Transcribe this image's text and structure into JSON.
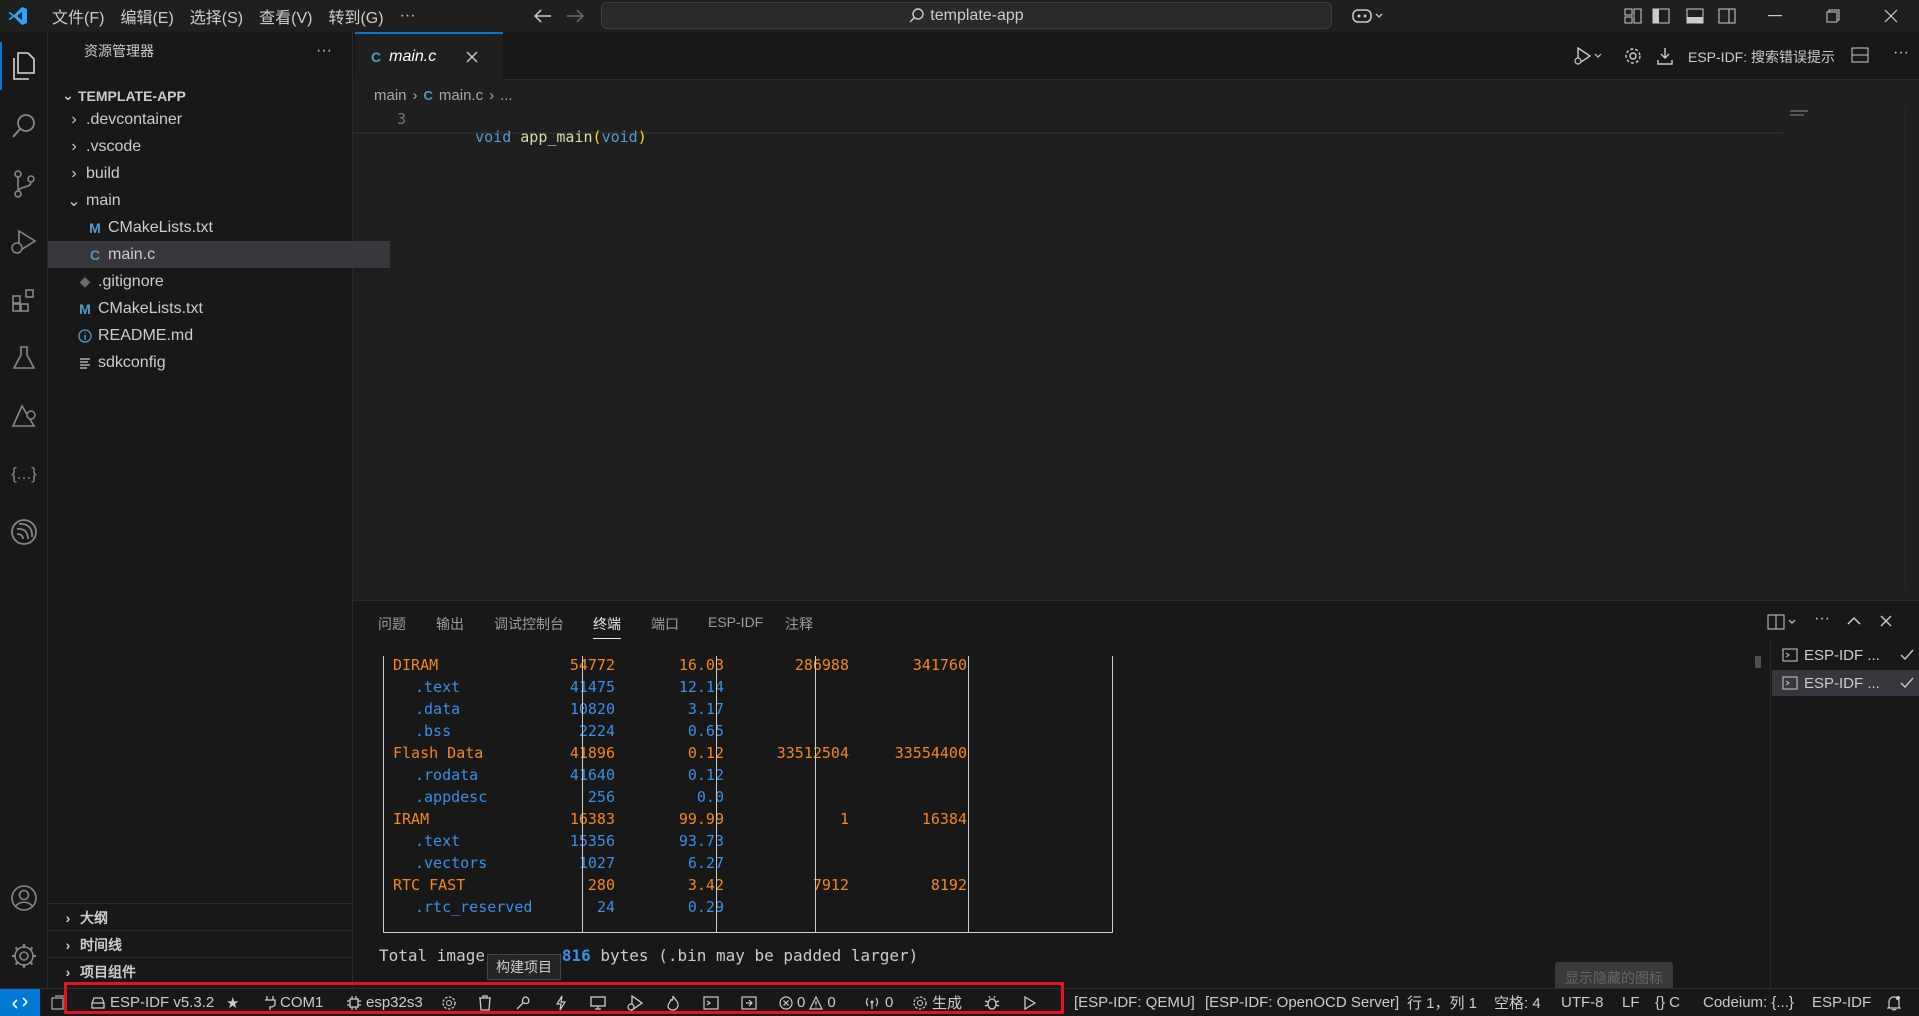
{
  "titlebar": {
    "menus": [
      "文件(F)",
      "编辑(E)",
      "选择(S)",
      "查看(V)",
      "转到(G)"
    ],
    "more": "···",
    "search_text": "template-app"
  },
  "explorer": {
    "title": "资源管理器",
    "more": "···",
    "root": "TEMPLATE-APP",
    "items": [
      {
        "label": ".devcontainer",
        "type": "folder-collapsed"
      },
      {
        "label": ".vscode",
        "type": "folder-collapsed"
      },
      {
        "label": "build",
        "type": "folder-collapsed"
      },
      {
        "label": "main",
        "type": "folder-expanded"
      },
      {
        "label": "CMakeLists.txt",
        "type": "cmake"
      },
      {
        "label": "main.c",
        "type": "c",
        "selected": true
      },
      {
        "label": ".gitignore",
        "type": "git"
      },
      {
        "label": "CMakeLists.txt",
        "type": "cmake"
      },
      {
        "label": "README.md",
        "type": "info"
      },
      {
        "label": "sdkconfig",
        "type": "text"
      }
    ],
    "bottom_sections": [
      "大纲",
      "时间线",
      "项目组件"
    ]
  },
  "editor": {
    "tab_icon": "C",
    "tab_label": "main.c",
    "breadcrumb": [
      "main",
      "main.c",
      "..."
    ],
    "line_number": "3",
    "code_keyword": "void",
    "code_func": "app_main",
    "code_paren_open": "(",
    "code_param": "void",
    "code_paren_close": ")",
    "actions_label": "ESP-IDF:  搜索错误提示"
  },
  "panel": {
    "tabs": [
      "问题",
      "输出",
      "调试控制台",
      "终端",
      "端口",
      "ESP-IDF",
      "注释"
    ],
    "active_tab": "终端",
    "terminals": [
      "ESP-IDF ...",
      "ESP-IDF ..."
    ],
    "rows": [
      {
        "name": "DIRAM",
        "level": 0,
        "used": "54772",
        "pct": "16.03",
        "remain": "286988",
        "total": "341760"
      },
      {
        "name": ".text",
        "level": 1,
        "used": "41475",
        "pct": "12.14",
        "remain": "",
        "total": ""
      },
      {
        "name": ".data",
        "level": 1,
        "used": "10820",
        "pct": "3.17",
        "remain": "",
        "total": ""
      },
      {
        "name": ".bss",
        "level": 1,
        "used": "2224",
        "pct": "0.65",
        "remain": "",
        "total": ""
      },
      {
        "name": "Flash Data",
        "level": 0,
        "used": "41896",
        "pct": "0.12",
        "remain": "33512504",
        "total": "33554400"
      },
      {
        "name": ".rodata",
        "level": 1,
        "used": "41640",
        "pct": "0.12",
        "remain": "",
        "total": ""
      },
      {
        "name": ".appdesc",
        "level": 1,
        "used": "256",
        "pct": "0.0",
        "remain": "",
        "total": ""
      },
      {
        "name": "IRAM",
        "level": 0,
        "used": "16383",
        "pct": "99.99",
        "remain": "1",
        "total": "16384"
      },
      {
        "name": ".text",
        "level": 1,
        "used": "15356",
        "pct": "93.73",
        "remain": "",
        "total": ""
      },
      {
        "name": ".vectors",
        "level": 1,
        "used": "1027",
        "pct": "6.27",
        "remain": "",
        "total": ""
      },
      {
        "name": "RTC FAST",
        "level": 0,
        "used": "280",
        "pct": "3.42",
        "remain": "7912",
        "total": "8192"
      },
      {
        "name": ".rtc_reserved",
        "level": 1,
        "used": "24",
        "pct": "0.29",
        "remain": "",
        "total": ""
      }
    ],
    "total_prefix": "Total image ",
    "total_hidden": "si",
    "total_value": "816",
    "total_suffix": " bytes (.bin may be padded larger)"
  },
  "tooltips": {
    "build": "构建项目",
    "hidden_icons": "显示隐藏的图标"
  },
  "statusbar": {
    "idf_version": "ESP-IDF v5.3.2",
    "port": "COM1",
    "target": "esp32s3",
    "errors": "0",
    "warnings": "0",
    "monitor_count": "0",
    "build_label": "生成",
    "qemu": "[ESP-IDF: QEMU]",
    "openocd": "[ESP-IDF: OpenOCD Server]",
    "cursor_pos": "行 1，列 1",
    "spaces": "空格: 4",
    "encoding": "UTF-8",
    "eol": "LF",
    "language": "{} C",
    "codeium": "Codeium: {...}",
    "esp_idf": "ESP-IDF"
  },
  "colors": {
    "accent": "#0078d4",
    "highlight_box": "#e81123",
    "orange": "#f5871f",
    "blue": "#3b8eea"
  }
}
